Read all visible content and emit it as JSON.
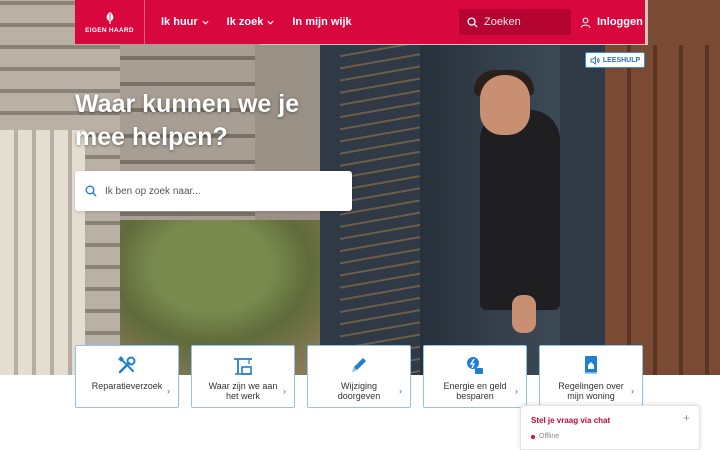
{
  "colors": {
    "brand": "#d8083f",
    "accent_blue": "#1f7fcf",
    "tile_border": "#8fc3ea"
  },
  "header": {
    "logo_text": "EIGEN HAARD",
    "nav": [
      {
        "label": "Ik huur",
        "has_dropdown": true
      },
      {
        "label": "Ik zoek",
        "has_dropdown": true
      },
      {
        "label": "In mijn wijk",
        "has_dropdown": false
      }
    ],
    "search_placeholder": "Zoeken",
    "login_label": "Inloggen"
  },
  "leeshulp": {
    "label": "LEESHULP",
    "icon": "speaker-icon"
  },
  "hero": {
    "title": "Waar kunnen we je mee helpen?",
    "search_placeholder": "Ik ben op zoek naar..."
  },
  "tiles": [
    {
      "label": "Reparatieverzoek",
      "icon": "tools-icon"
    },
    {
      "label": "Waar zijn we aan het werk",
      "icon": "crane-icon"
    },
    {
      "label": "Wijziging doorgeven",
      "icon": "pencil-icon"
    },
    {
      "label": "Energie en geld besparen",
      "icon": "energy-money-icon"
    },
    {
      "label": "Regelingen over mijn woning",
      "icon": "house-document-icon"
    }
  ],
  "chat": {
    "title": "Stel je vraag via chat",
    "status": "Offline"
  }
}
